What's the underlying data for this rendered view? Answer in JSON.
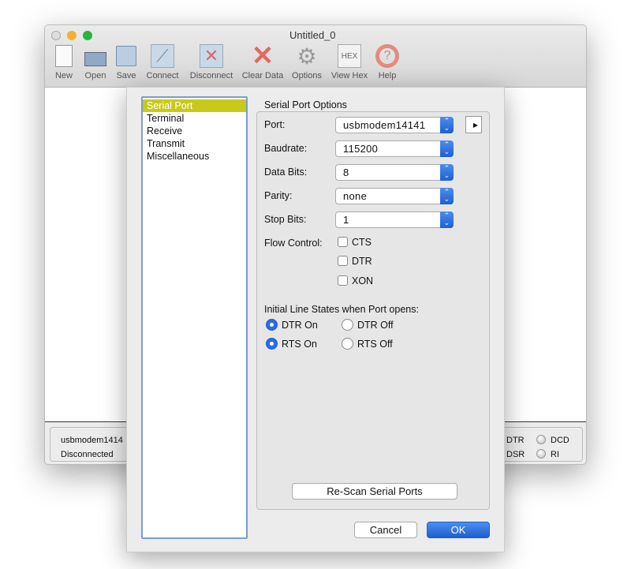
{
  "window": {
    "title": "Untitled_0"
  },
  "toolbar": [
    {
      "label": "New",
      "icon": "new-document-icon"
    },
    {
      "label": "Open",
      "icon": "open-folder-icon"
    },
    {
      "label": "Save",
      "icon": "save-disk-icon"
    },
    {
      "label": "Connect",
      "icon": "plug-icon"
    },
    {
      "label": "Disconnect",
      "icon": "unplug-icon"
    },
    {
      "label": "Clear Data",
      "icon": "red-x-icon"
    },
    {
      "label": "Options",
      "icon": "gear-icon"
    },
    {
      "label": "View Hex",
      "icon": "hex-icon",
      "glyph": "HEX"
    },
    {
      "label": "Help",
      "icon": "lifebuoy-icon"
    }
  ],
  "status": {
    "port": "usbmodem1414",
    "state": "Disconnected",
    "dtr": "DTR",
    "dsr": "DSR",
    "dcd": "DCD",
    "ri": "RI"
  },
  "sidebar": {
    "items": [
      {
        "label": "Serial Port",
        "selected": true
      },
      {
        "label": "Terminal"
      },
      {
        "label": "Receive"
      },
      {
        "label": "Transmit"
      },
      {
        "label": "Miscellaneous"
      }
    ],
    "selected_color": "#c9c91a"
  },
  "options": {
    "heading": "Serial Port Options",
    "port_label": "Port:",
    "port": "usbmodem14141",
    "baud_label": "Baudrate:",
    "baud": "115200",
    "databits_label": "Data Bits:",
    "databits": "8",
    "parity_label": "Parity:",
    "parity": "none",
    "stopbits_label": "Stop Bits:",
    "stopbits": "1",
    "flow_label": "Flow Control:",
    "flow": [
      {
        "label": "CTS",
        "checked": false
      },
      {
        "label": "DTR",
        "checked": false
      },
      {
        "label": "XON",
        "checked": false
      }
    ],
    "line_states_label": "Initial Line States when Port opens:",
    "dtr_on": "DTR On",
    "dtr_off": "DTR Off",
    "rts_on": "RTS On",
    "rts_off": "RTS Off",
    "dtr_selected": "DTR On",
    "rts_selected": "RTS On",
    "rescan": "Re-Scan Serial Ports"
  },
  "buttons": {
    "cancel": "Cancel",
    "ok": "OK"
  },
  "accent": "#1f5fd0"
}
